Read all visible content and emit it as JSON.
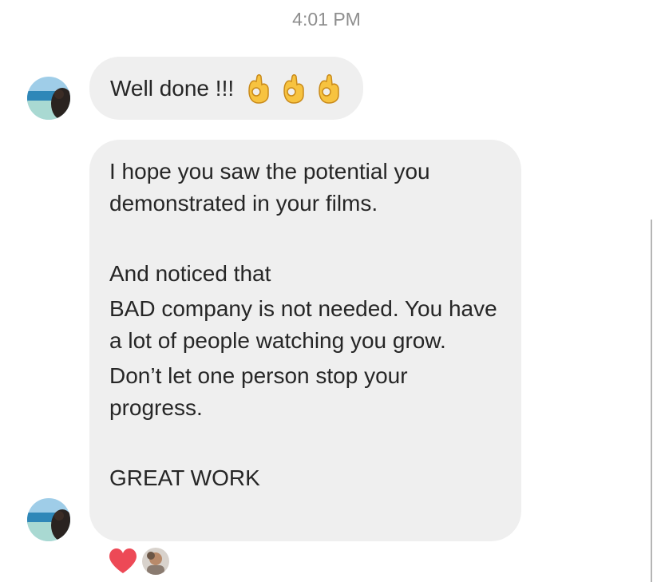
{
  "chat": {
    "timestamp": "4:01 PM",
    "messages": [
      {
        "text": "Well done !!!",
        "emojis": [
          "ok-hand-emoji",
          "ok-hand-emoji",
          "ok-hand-emoji"
        ]
      },
      {
        "paragraphs": [
          "I hope you saw the potential you demonstrated in your films.",
          "And noticed that",
          "BAD company is not needed. You have a lot of people watching you grow.",
          "Don’t let one person stop your progress.",
          "GREAT WORK"
        ]
      }
    ],
    "reactions": [
      "heart-icon",
      "reactor-avatar"
    ]
  },
  "colors": {
    "bubble": "#efefef",
    "text": "#262626",
    "timestamp": "#8e8e8e",
    "heart": "#ed4956"
  }
}
